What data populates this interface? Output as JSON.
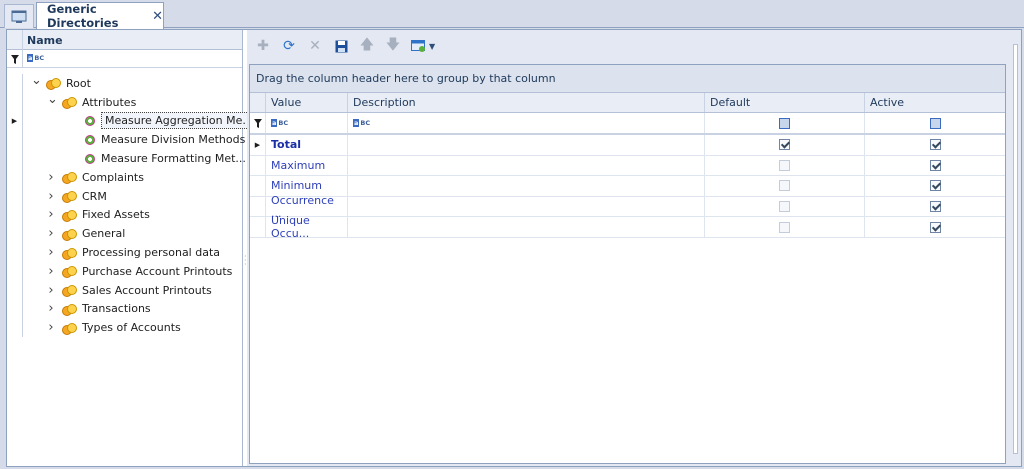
{
  "tabs": {
    "home_icon": "window-icon",
    "document_tab_label": "Generic Directories",
    "close_glyph": "✕"
  },
  "tree": {
    "column_header": "Name",
    "items": [
      {
        "label": "Root",
        "level": 0,
        "expanded": true,
        "icon": "folder-icon"
      },
      {
        "label": "Attributes",
        "level": 1,
        "expanded": true,
        "icon": "folder-icon"
      },
      {
        "label": "Measure Aggregation Me...",
        "level": 2,
        "icon": "gear-icon",
        "selected": true
      },
      {
        "label": "Measure Division Methods",
        "level": 2,
        "icon": "gear-icon"
      },
      {
        "label": "Measure Formatting Met...",
        "level": 2,
        "icon": "gear-icon"
      },
      {
        "label": "Complaints",
        "level": 1,
        "expanded": false,
        "icon": "folder-icon"
      },
      {
        "label": "CRM",
        "level": 1,
        "expanded": false,
        "icon": "folder-icon"
      },
      {
        "label": "Fixed Assets",
        "level": 1,
        "expanded": false,
        "icon": "folder-icon"
      },
      {
        "label": "General",
        "level": 1,
        "expanded": false,
        "icon": "folder-icon"
      },
      {
        "label": "Processing personal data",
        "level": 1,
        "expanded": false,
        "icon": "folder-icon"
      },
      {
        "label": "Purchase Account Printouts",
        "level": 1,
        "expanded": false,
        "icon": "folder-icon"
      },
      {
        "label": "Sales Account Printouts",
        "level": 1,
        "expanded": false,
        "icon": "folder-icon"
      },
      {
        "label": "Transactions",
        "level": 1,
        "expanded": false,
        "icon": "folder-icon"
      },
      {
        "label": "Types of Accounts",
        "level": 1,
        "expanded": false,
        "icon": "folder-icon"
      }
    ]
  },
  "toolbar": {
    "buttons": [
      "add-icon",
      "refresh-icon",
      "delete-icon",
      "save-icon",
      "move-up-icon",
      "move-down-icon",
      "view-options-icon"
    ]
  },
  "grid": {
    "group_panel_text": "Drag the column header here to group by that column",
    "columns": [
      "Value",
      "Description",
      "Default",
      "Active"
    ],
    "rows": [
      {
        "value": "Total",
        "description": "",
        "default": true,
        "active": true,
        "current": true
      },
      {
        "value": "Maximum",
        "description": "",
        "default": false,
        "active": true
      },
      {
        "value": "Minimum",
        "description": "",
        "default": false,
        "active": true
      },
      {
        "value": "Occurrence ...",
        "description": "",
        "default": false,
        "active": true
      },
      {
        "value": "Unique Occu...",
        "description": "",
        "default": false,
        "active": true
      }
    ]
  },
  "colors": {
    "accent": "#2e73c8",
    "value_text": "#2d3fb8",
    "header_bg": "#e9edf5"
  }
}
